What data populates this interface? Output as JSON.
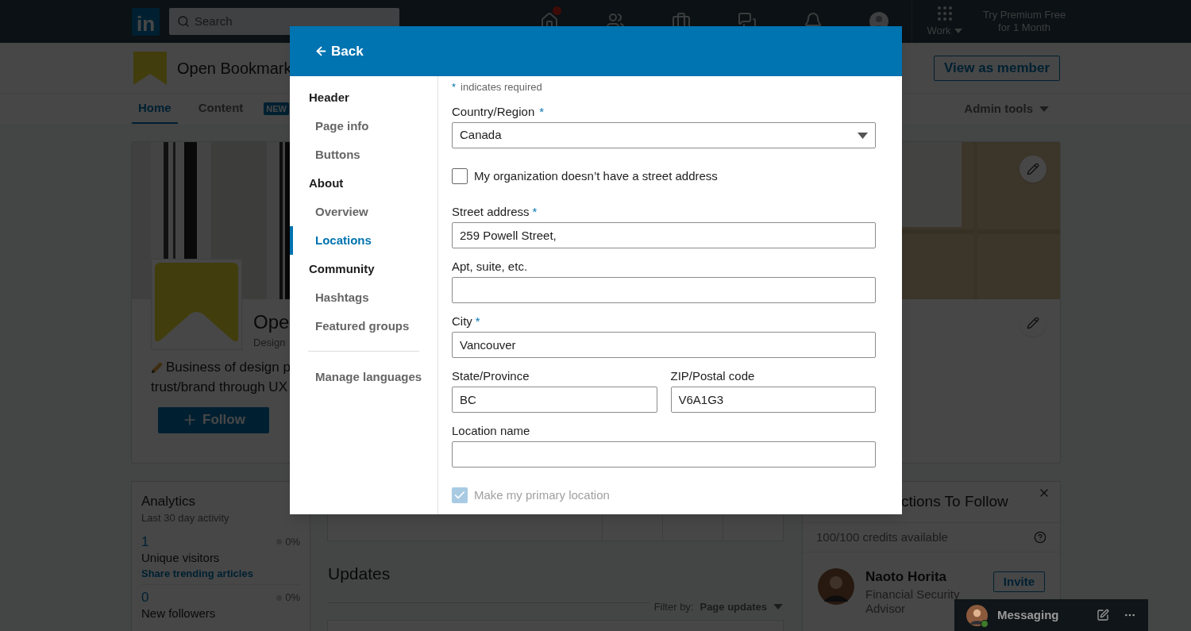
{
  "nav": {
    "logo": "in",
    "search": {
      "placeholder": "Search"
    },
    "items": [
      {
        "kind": "home",
        "badge": true
      },
      {
        "kind": "network",
        "badge": false
      },
      {
        "kind": "jobs",
        "badge": false
      },
      {
        "kind": "messaging",
        "badge": false
      },
      {
        "kind": "notifications",
        "badge": false
      },
      {
        "kind": "me",
        "badge": false
      }
    ],
    "work": "Work",
    "premium": "Try Premium Free for 1 Month"
  },
  "page_header": {
    "name": "Open Bookmark",
    "view_button": "View as member",
    "tabs": [
      {
        "label": "Home",
        "selected": true
      },
      {
        "label": "Content",
        "selected": false
      }
    ],
    "new_badge": "NEW",
    "admin_tools": "Admin tools"
  },
  "profile_card": {
    "name": "Ope",
    "tagline": "Design",
    "description": [
      "Business of design p",
      "trust/brand through UX"
    ],
    "follow_button": "Follow"
  },
  "analytics": {
    "title": "Analytics",
    "subtitle": "Last 30 day activity",
    "stats": [
      {
        "value": "1",
        "change": "0%",
        "label": "Unique visitors",
        "link": "Share trending articles"
      },
      {
        "value": "0",
        "change": "0%",
        "label": "New followers"
      }
    ]
  },
  "updates": {
    "title": "Updates",
    "filter_label": "Filter by:",
    "filter_value": "Page updates"
  },
  "suggestions": {
    "title": "ctions To Follow",
    "credits": "100/100 credits available",
    "people": [
      {
        "name": "Naoto Horita",
        "headline": [
          "Financial Security",
          "Advisor"
        ],
        "invite": "Invite"
      }
    ]
  },
  "messaging": {
    "label": "Messaging"
  },
  "modal": {
    "back": "Back",
    "nav": [
      {
        "label": "Header",
        "kind": "section",
        "selected": false
      },
      {
        "label": "Page info",
        "kind": "item",
        "selected": false
      },
      {
        "label": "Buttons",
        "kind": "item",
        "selected": false
      },
      {
        "label": "About",
        "kind": "section",
        "selected": false
      },
      {
        "label": "Overview",
        "kind": "item",
        "selected": false
      },
      {
        "label": "Locations",
        "kind": "item",
        "selected": true
      },
      {
        "label": "Community",
        "kind": "section",
        "selected": false
      },
      {
        "label": "Hashtags",
        "kind": "item",
        "selected": false
      },
      {
        "label": "Featured groups",
        "kind": "item",
        "selected": false
      },
      {
        "label": "Manage languages",
        "kind": "footer",
        "selected": false
      }
    ],
    "required_mark": "*",
    "required_note": "indicates required",
    "fields": [
      {
        "kind": "select",
        "label": "Country/Region",
        "required": true,
        "value": "Canada"
      },
      {
        "kind": "checkbox",
        "label": "My organization doesn’t have a street address",
        "checked": false,
        "disabled": false
      },
      {
        "kind": "text",
        "label": "Street address",
        "required": true,
        "value": "259 Powell Street,"
      },
      {
        "kind": "text",
        "label": "Apt, suite, etc.",
        "required": false
      },
      {
        "kind": "text",
        "label": "City",
        "required": true,
        "value": "Vancouver"
      },
      {
        "kind": "pair",
        "fields": [
          {
            "label": "State/Province",
            "required": false,
            "value": "BC"
          },
          {
            "label": "ZIP/Postal code",
            "required": false,
            "value": "V6A1G3"
          }
        ]
      },
      {
        "kind": "text",
        "label": "Location name",
        "required": false
      },
      {
        "kind": "checkbox",
        "label": "Make my primary location",
        "checked": true,
        "disabled": true
      }
    ]
  }
}
